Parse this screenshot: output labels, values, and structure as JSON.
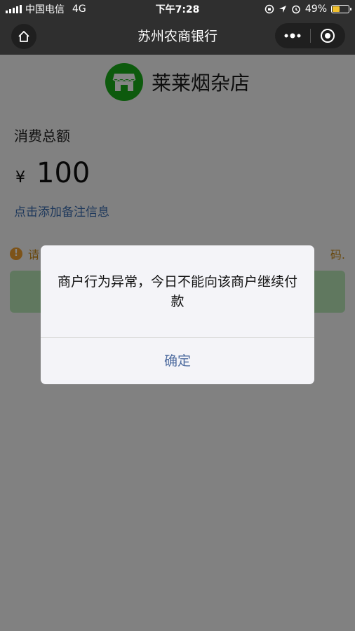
{
  "status_bar": {
    "carrier": "中国电信",
    "network": "4G",
    "time": "下午7:28",
    "battery_percent": "49%",
    "battery_level": 0.49
  },
  "nav": {
    "title": "苏州农商银行"
  },
  "merchant": {
    "name": "莱莱烟杂店"
  },
  "payment": {
    "amount_label": "消费总额",
    "currency_symbol": "¥",
    "amount": "100",
    "remark_link": "点击添加备注信息"
  },
  "warning": {
    "text_start": "请",
    "text_end": "码."
  },
  "dialog": {
    "message": "商户行为异常，今日不能向该商户继续付款",
    "confirm_label": "确定"
  },
  "colors": {
    "brand_green": "#1aad19",
    "link_blue": "#3c6db1",
    "warning_orange": "#f0a030",
    "dialog_button": "#4c6a9e"
  }
}
